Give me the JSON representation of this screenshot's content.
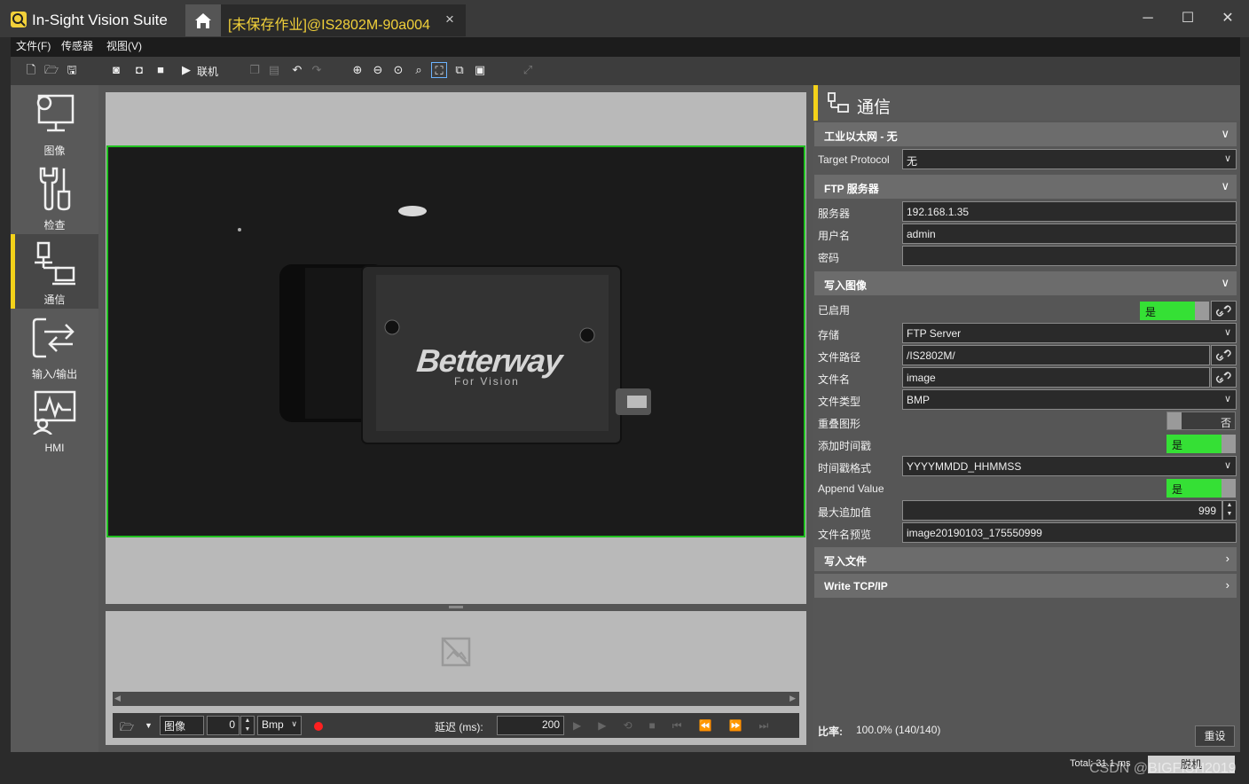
{
  "app": {
    "title": "In-Sight Vision Suite",
    "doc_tab": "[未保存作业]@IS2802M-90a004",
    "close_tab": "×"
  },
  "window": {
    "minimize": "─",
    "maximize": "☐",
    "close": "✕"
  },
  "menu": [
    "文件(F)",
    "传感器",
    "视图(V)"
  ],
  "toolbar": {
    "online_label": "联机"
  },
  "nav": [
    {
      "label": "图像",
      "icon": "image-settings-icon"
    },
    {
      "label": "检查",
      "icon": "tools-icon"
    },
    {
      "label": "通信",
      "icon": "network-icon",
      "active": true
    },
    {
      "label": "输入/输出",
      "icon": "io-icon"
    },
    {
      "label": "HMI",
      "icon": "hmi-icon"
    }
  ],
  "camera_image": {
    "brand": "Betterway",
    "tagline": "For Vision"
  },
  "bottom": {
    "image_label": "图像",
    "index": "0",
    "format": "Bmp",
    "delay_label": "延迟 (ms):",
    "delay_value": "200"
  },
  "panel": {
    "title": "通信",
    "sections": {
      "industrial": "工业以太网 - 无",
      "ftp": "FTP 服务器",
      "write_image": "写入图像",
      "write_file": "写入文件",
      "write_tcp": "Write TCP/IP"
    },
    "target_protocol": {
      "label": "Target Protocol",
      "value": "无"
    },
    "ftp": {
      "server_label": "服务器",
      "server_value": "192.168.1.35",
      "user_label": "用户名",
      "user_value": "admin",
      "password_label": "密码",
      "password_value": ""
    },
    "write_image": {
      "enabled_label": "已启用",
      "enabled_value": "是",
      "storage_label": "存储",
      "storage_value": "FTP Server",
      "path_label": "文件路径",
      "path_value": "/IS2802M/",
      "filename_label": "文件名",
      "filename_value": "image",
      "filetype_label": "文件类型",
      "filetype_value": "BMP",
      "overlay_label": "重叠图形",
      "overlay_value": "否",
      "timestamp_label": "添加时间戳",
      "timestamp_value": "是",
      "tsformat_label": "时间戳格式",
      "tsformat_value": "YYYYMMDD_HHMMSS",
      "append_label": "Append Value",
      "append_value": "是",
      "maxappend_label": "最大追加值",
      "maxappend_value": "999",
      "preview_label": "文件名预览",
      "preview_value": "image20190103_175550999"
    },
    "ratio_label": "比率:",
    "ratio_value": "100.0% (140/140)",
    "reset_button": "重设"
  },
  "status": {
    "total": "Total: 31.1 ms",
    "mode": "脱机",
    "watermark": "CSDN @BIGFISH2019"
  },
  "colors": {
    "accent": "#f4d21a",
    "toggle_on": "#35e035",
    "image_border": "#20c020"
  }
}
